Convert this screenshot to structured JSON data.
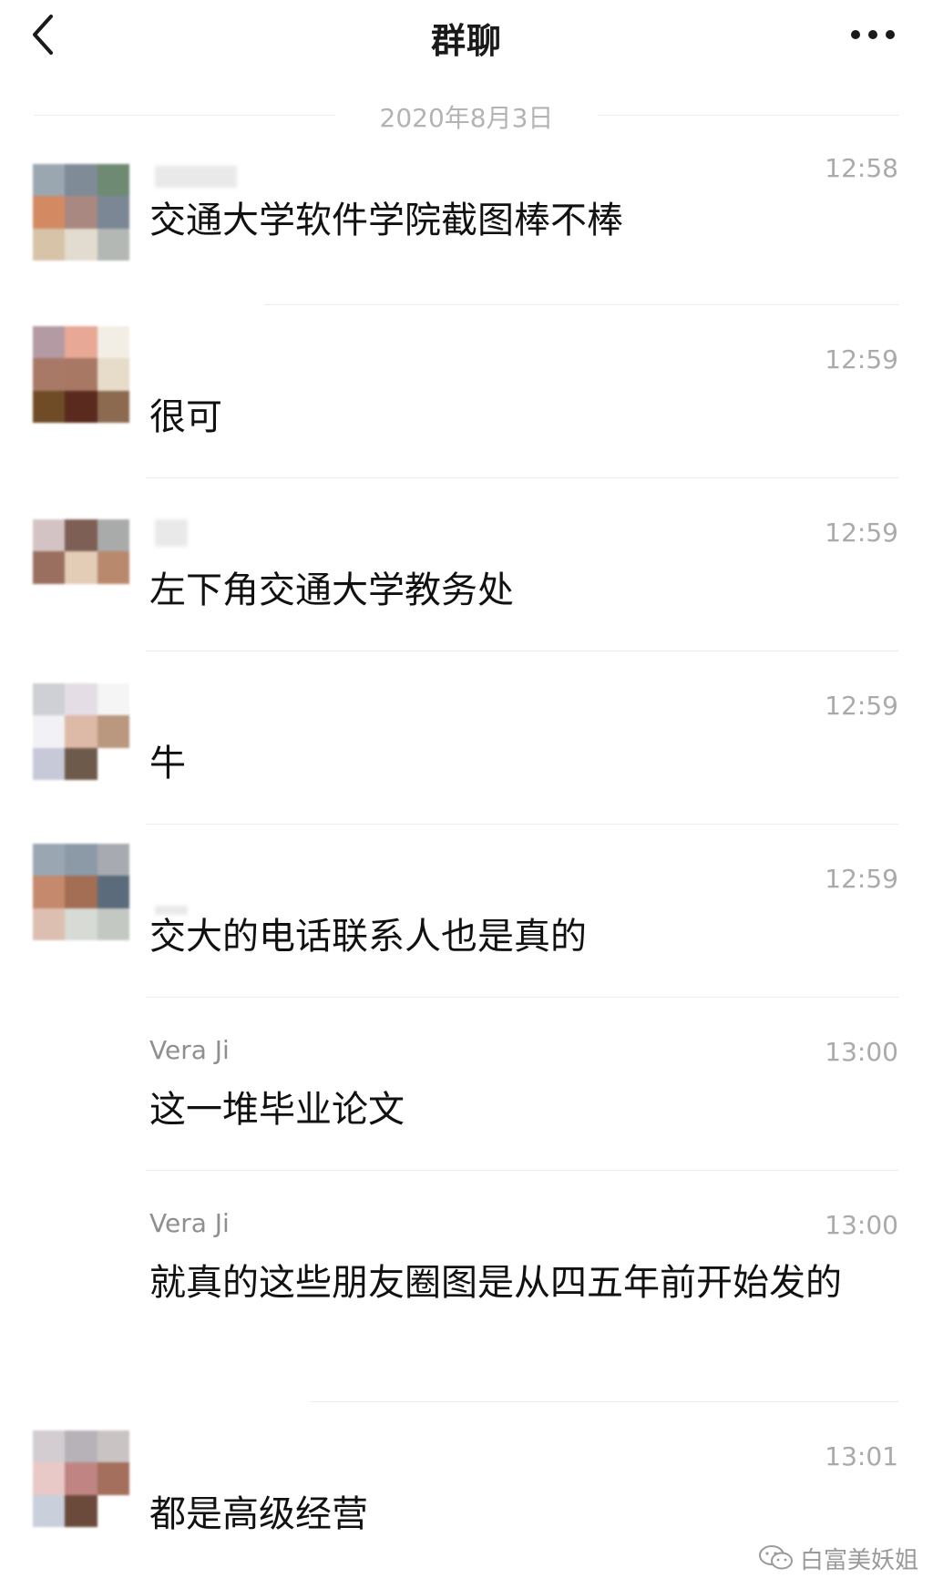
{
  "header": {
    "title": "群聊",
    "back_icon": "chevron-left-icon",
    "more_icon": "more-horizontal-icon"
  },
  "date_separator": "2020年8月3日",
  "messages": [
    {
      "sender": "",
      "time": "12:58",
      "text": "交通大学软件学院截图棒不棒",
      "avatar_colors": [
        "#9aa7b0",
        "#7f8b97",
        "#6f8a72",
        "#d38a63",
        "#a88880",
        "#7b8794",
        "#d7c3a8",
        "#e1dccf",
        "#b4b8b4"
      ]
    },
    {
      "sender": "",
      "time": "12:59",
      "text": "很可",
      "avatar_colors": [
        "#b39aa3",
        "#e7a895",
        "#f3eee5",
        "#a97968",
        "#a87864",
        "#e6dcc9",
        "#6f4c25",
        "#5a2a1e",
        "#8b6a50"
      ]
    },
    {
      "sender": "",
      "time": "12:59",
      "text": "左下角交通大学教务处",
      "avatar_colors": [
        "#d4c3c4",
        "#7e5f55",
        "#a9abaa",
        "#9a6f5f",
        "#e3cdb6",
        "#b9896e",
        "#ffffff",
        "#ffffff",
        "#ffffff"
      ]
    },
    {
      "sender": "",
      "time": "12:59",
      "text": "牛",
      "avatar_colors": [
        "#cfcfd6",
        "#e5dde5",
        "#f5f5f5",
        "#f2f2f6",
        "#ddb9a7",
        "#b9987f",
        "#c7c9d9",
        "#6e5a4a",
        "#ffffff"
      ]
    },
    {
      "sender": "",
      "time": "12:59",
      "text": "交大的电话联系人也是真的",
      "avatar_colors": [
        "#9aa6b2",
        "#8c9aa8",
        "#a7aab1",
        "#c58a6d",
        "#a46e55",
        "#5b6b7b",
        "#dcbfb0",
        "#d7dad5",
        "#c4c8c2"
      ]
    },
    {
      "sender": "Vera Ji",
      "time": "13:00",
      "text": "这一堆毕业论文",
      "avatar_colors": []
    },
    {
      "sender": "Vera Ji",
      "time": "13:00",
      "text": "就真的这些朋友圈图是从四五年前开始发的",
      "avatar_colors": []
    },
    {
      "sender": "",
      "time": "13:01",
      "text": "都是高级经营",
      "avatar_colors": [
        "#d3cdd2",
        "#b7b2b7",
        "#c9c3c3",
        "#e8c9c7",
        "#c08583",
        "#a46f5c",
        "#c9cfdb",
        "#6b4a3c",
        "#ffffff"
      ]
    }
  ],
  "watermark": {
    "icon": "wechat-icon",
    "text": "白富美妖姐"
  }
}
